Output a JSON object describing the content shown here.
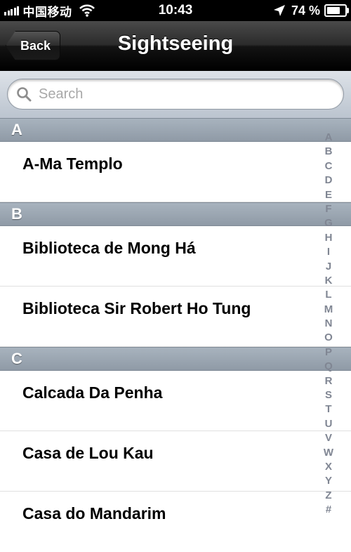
{
  "status_bar": {
    "carrier": "中国移动",
    "time": "10:43",
    "battery_percent": "74 %",
    "battery_level": 0.74,
    "icons": [
      "signal-icon",
      "wifi-icon",
      "location-arrow-icon",
      "battery-icon"
    ]
  },
  "nav": {
    "back_label": "Back",
    "title": "Sightseeing"
  },
  "search": {
    "placeholder": "Search"
  },
  "sections": [
    {
      "header": "A",
      "rows": [
        "A-Ma Templo"
      ]
    },
    {
      "header": "B",
      "rows": [
        "Biblioteca de Mong Há",
        "Biblioteca Sir Robert Ho Tung"
      ]
    },
    {
      "header": "C",
      "rows": [
        "Calcada Da Penha",
        "Casa de Lou Kau",
        "Casa do Mandarim"
      ]
    }
  ],
  "index": [
    "A",
    "B",
    "C",
    "D",
    "E",
    "F",
    "G",
    "H",
    "I",
    "J",
    "K",
    "L",
    "M",
    "N",
    "O",
    "P",
    "Q",
    "R",
    "S",
    "T",
    "U",
    "V",
    "W",
    "X",
    "Y",
    "Z",
    "#"
  ],
  "colors": {
    "nav_background": "#000000",
    "section_header": "#99a4b0",
    "index_text": "#808693"
  }
}
